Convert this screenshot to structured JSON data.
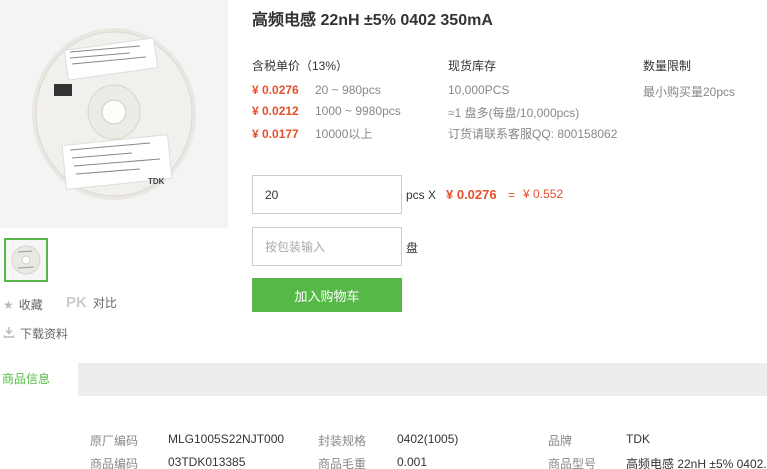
{
  "product": {
    "title": "高频电感 22nH ±5% 0402 350mA",
    "image_brand": "TDK"
  },
  "sidebar": {
    "favorite_label": "收藏",
    "pk_label": "PK",
    "compare_label": "对比",
    "download_label": "下载资料"
  },
  "pricing": {
    "header": "含税单价（13%）",
    "tiers": [
      {
        "price": "¥ 0.0276",
        "range": "20 ~ 980pcs"
      },
      {
        "price": "¥ 0.0212",
        "range": "1000 ~ 9980pcs"
      },
      {
        "price": "¥ 0.0177",
        "range": "10000以上"
      }
    ]
  },
  "stock": {
    "header": "现货库存",
    "quantity": "10,000PCS",
    "reels": "≈1 盘多(每盘/10,000pcs)",
    "contact": "订货请联系客服QQ: 800158062"
  },
  "limit": {
    "header": "数量限制",
    "text": "最小购买量20pcs"
  },
  "order": {
    "quantity_value": "20",
    "pcs_label": "pcs X",
    "unit_price": "¥ 0.0276",
    "equals": "=",
    "total": "¥ 0.552",
    "pack_placeholder": "按包装输入",
    "pack_unit": "盘",
    "add_to_cart": "加入购物车"
  },
  "tabs": {
    "active": "商品信息"
  },
  "specs": {
    "rows": [
      [
        {
          "key": "原厂编码",
          "value": "MLG1005S22NJT000"
        },
        {
          "key": "封装规格",
          "value": "0402(1005)"
        },
        {
          "key": "品牌",
          "value": "TDK"
        }
      ],
      [
        {
          "key": "商品编码",
          "value": "03TDK013385"
        },
        {
          "key": "商品毛重",
          "value": "0.001"
        },
        {
          "key": "商品型号",
          "value": "高频电感 22nH ±5% 0402."
        }
      ]
    ]
  },
  "colors": {
    "accent_green": "#56b947",
    "price_red": "#e5502c"
  }
}
